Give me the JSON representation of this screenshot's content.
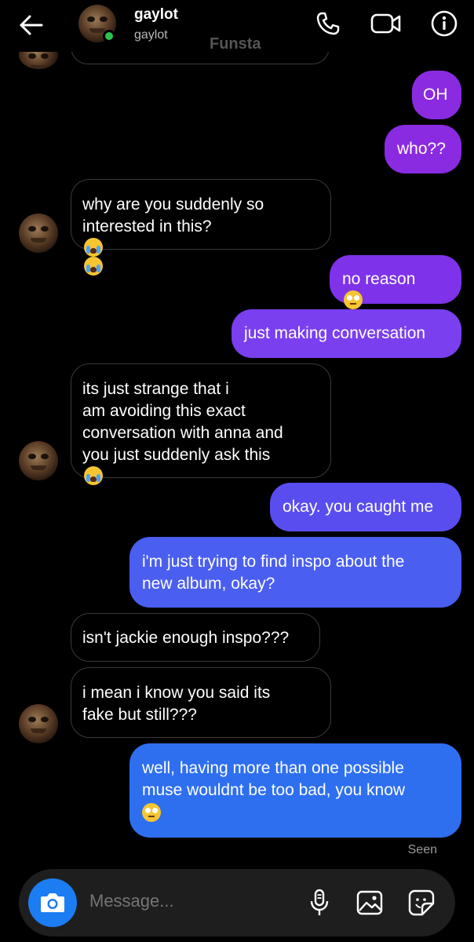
{
  "header": {
    "name": "gaylot",
    "handle": "gaylot",
    "overlay_label": "Funsta",
    "icons": [
      "back-arrow-icon",
      "phone-icon",
      "video-icon",
      "info-icon"
    ]
  },
  "messages": [
    {
      "dir": "out",
      "text": "OH",
      "color": "#8a2be2"
    },
    {
      "dir": "out",
      "text": "who??",
      "color": "#8a2be2"
    },
    {
      "dir": "in",
      "lines": [
        "why are you suddenly so",
        "interested in this?"
      ],
      "emoji": "loudly-crying-face x2"
    },
    {
      "dir": "out",
      "text": "no reason",
      "emoji": "face-with-rolling-eyes",
      "color": "#7e33ea"
    },
    {
      "dir": "out",
      "text": "just making conversation",
      "color": "#7a3fef"
    },
    {
      "dir": "in",
      "lines": [
        "its just strange that i",
        "am avoiding this exact",
        "conversation with anna and",
        "you just suddenly ask this"
      ],
      "emoji": "loudly-crying-face"
    },
    {
      "dir": "out",
      "text": "okay. you caught me",
      "color": "#5a4df0"
    },
    {
      "dir": "out",
      "lines": [
        "i'm just trying to find inspo about the",
        "new album, okay?"
      ],
      "color": "#4a5ef0"
    },
    {
      "dir": "in",
      "text": "isn't jackie enough inspo???"
    },
    {
      "dir": "in",
      "lines": [
        "i mean i know you said its",
        "fake but still???"
      ]
    },
    {
      "dir": "out",
      "lines": [
        "well, having more than one possible",
        "muse wouldnt be too bad, you know"
      ],
      "emoji": "face-with-rolling-eyes",
      "color": "#2e6ff0"
    }
  ],
  "seen_label": "Seen",
  "composer": {
    "placeholder": "Message...",
    "icons": [
      "camera-icon",
      "microphone-icon",
      "gallery-icon",
      "sticker-icon"
    ],
    "camera_color": "#1c7cf2"
  }
}
